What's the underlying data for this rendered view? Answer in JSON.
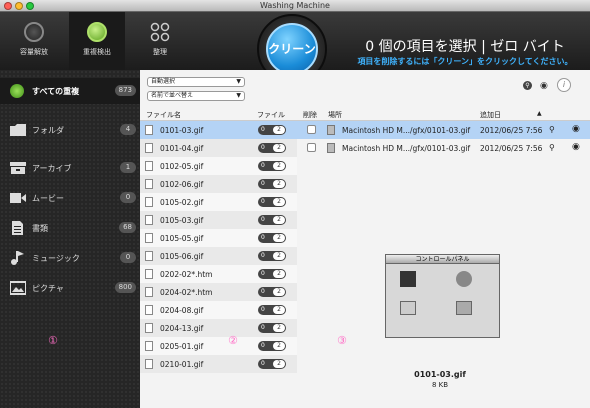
{
  "window": {
    "title": "Washing Machine"
  },
  "toolbar": {
    "tabs": [
      {
        "label": "容量解放",
        "icon": "capacity-icon",
        "selected": false
      },
      {
        "label": "重複検出",
        "icon": "duplicate-icon",
        "selected": true
      },
      {
        "label": "整理",
        "icon": "organize-icon",
        "selected": false
      }
    ],
    "clean_label": "クリーン",
    "summary": "0 個の項目を選択 | ゼロ バイト",
    "hint": "項目を削除するには「クリーン」をクリックしてください。"
  },
  "sidebar": {
    "items": [
      {
        "label": "すべての重複",
        "count": "873",
        "icon": "globe-icon"
      },
      {
        "label": "フォルダ",
        "count": "4",
        "icon": "folder-icon"
      },
      {
        "label": "アーカイブ",
        "count": "1",
        "icon": "archive-icon"
      },
      {
        "label": "ムービー",
        "count": "0",
        "icon": "movie-icon"
      },
      {
        "label": "書類",
        "count": "68",
        "icon": "document-icon"
      },
      {
        "label": "ミュージック",
        "count": "0",
        "icon": "music-icon"
      },
      {
        "label": "ピクチャ",
        "count": "800",
        "icon": "picture-icon"
      }
    ],
    "marker": "①"
  },
  "list": {
    "auto_select": "自動選択",
    "sort": "名前で並べ替え",
    "header": {
      "name": "ファイル名",
      "files": "ファイル",
      "delete": "削除",
      "location": "場所",
      "added": "追加日"
    },
    "rows": [
      {
        "name": "0101-03.gif",
        "count": "2",
        "selected": true
      },
      {
        "name": "0101-04.gif",
        "count": "2",
        "selected": false
      },
      {
        "name": "0102-05.gif",
        "count": "2",
        "selected": false
      },
      {
        "name": "0102-06.gif",
        "count": "2",
        "selected": false
      },
      {
        "name": "0105-02.gif",
        "count": "2",
        "selected": false
      },
      {
        "name": "0105-03.gif",
        "count": "2",
        "selected": false
      },
      {
        "name": "0105-05.gif",
        "count": "2",
        "selected": false
      },
      {
        "name": "0105-06.gif",
        "count": "2",
        "selected": false
      },
      {
        "name": "0202-02*.htm",
        "count": "2",
        "selected": false
      },
      {
        "name": "0204-02*.htm",
        "count": "2",
        "selected": false
      },
      {
        "name": "0204-08.gif",
        "count": "2",
        "selected": false
      },
      {
        "name": "0204-13.gif",
        "count": "2",
        "selected": false
      },
      {
        "name": "0205-01.gif",
        "count": "2",
        "selected": false
      },
      {
        "name": "0210-01.gif",
        "count": "2",
        "selected": false
      }
    ],
    "marker": "②"
  },
  "detail": {
    "rows": [
      {
        "location": "Macintosh HD M.../gfx/0101-03.gif",
        "date": "2012/06/25 7:56"
      },
      {
        "location": "Macintosh HD M.../gfx/0101-03.gif",
        "date": "2012/06/25 7:56"
      }
    ],
    "preview_title": "コントロールパネル",
    "preview_name": "0101-03.gif",
    "preview_size": "8 KB",
    "marker": "③"
  },
  "colors": {
    "accent": "#3fb4ff",
    "selection": "#b4d3f5",
    "tab_active": "#7ec63a"
  }
}
